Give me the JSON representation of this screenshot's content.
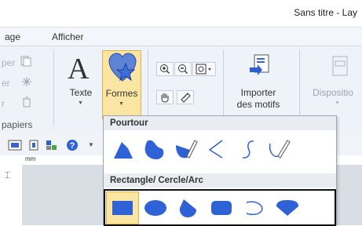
{
  "window": {
    "title": "Sans titre - Lay"
  },
  "menu": {
    "items": [
      "age",
      "Afficher"
    ]
  },
  "ribbon": {
    "ghost_labels": [
      "per",
      "er",
      "r"
    ],
    "group_label": "papiers",
    "texte_label": "Texte",
    "formes_label": "Formes",
    "importer_label_1": "Importer",
    "importer_label_2": "des motifs",
    "disposition_label": "Dispositio"
  },
  "dropdown": {
    "pourtour_header": "Pourtour",
    "rect_header": "Rectangle/ Cercle/Arc"
  },
  "ruler": {
    "unit": "mm"
  },
  "colors": {
    "shape_blue": "#2f62d6",
    "highlight": "#fbe5a3",
    "highlight_border": "#e2b14a"
  }
}
